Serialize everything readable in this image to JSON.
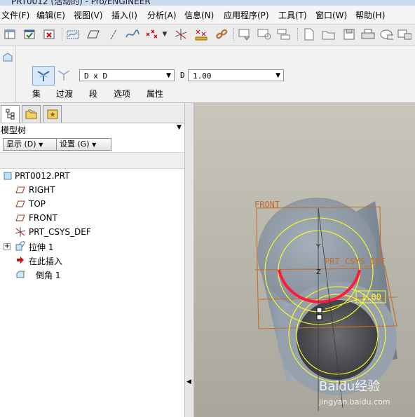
{
  "window": {
    "title": "PRT0012 (活动的) - Pro/ENGINEER"
  },
  "menu": [
    "文件(F)",
    "编辑(E)",
    "视图(V)",
    "插入(I)",
    "分析(A)",
    "信息(N)",
    "应用程序(P)",
    "工具(T)",
    "窗口(W)",
    "帮助(H)"
  ],
  "toolbar": {
    "icons": [
      "window-icon",
      "save-window-icon",
      "close-window-icon",
      "datum-display-icon",
      "plane-icon",
      "axis-icon",
      "curve-icon",
      "point-icon",
      "dropdown-arrow-icon",
      "csys-icon",
      "analysis-icon",
      "link-icon",
      "view-manager-icon",
      "regenerate-icon",
      "layers-icon",
      "new-file-icon",
      "open-file-icon",
      "save-icon",
      "print-icon",
      "email-icon",
      "rename-icon"
    ]
  },
  "dashboard": {
    "type_combo": "D x D",
    "d_label": "D",
    "d_value": "1.00",
    "tabs": [
      "集",
      "过渡",
      "段",
      "选项",
      "属性"
    ]
  },
  "model_tree": {
    "title": "模型树",
    "show_button": "显示 (D)",
    "settings_button": "设置 (G)",
    "items": [
      {
        "label": "PRT0012.PRT",
        "icon": "part-icon"
      },
      {
        "label": "RIGHT",
        "icon": "datum-plane-icon"
      },
      {
        "label": "TOP",
        "icon": "datum-plane-icon"
      },
      {
        "label": "FRONT",
        "icon": "datum-plane-icon"
      },
      {
        "label": "PRT_CSYS_DEF",
        "icon": "csys-icon"
      },
      {
        "label": "拉伸 1",
        "icon": "extrude-icon"
      },
      {
        "label": "在此插入",
        "icon": "insert-here-arrow-icon"
      },
      {
        "label": "倒角 1",
        "icon": "chamfer-icon"
      }
    ]
  },
  "viewport": {
    "front_label": "FRONT",
    "csys_label": "PRT_CSYS_DEF",
    "axis_y": "Y",
    "axis_z": "Z",
    "dim_value": "1.00",
    "colors": {
      "highlight": "#ff1a3c",
      "preview": "#ffff00",
      "datum": "#c46e2a"
    }
  },
  "watermark": {
    "text": "Baidu经验",
    "url": "jingyan.baidu.com"
  }
}
